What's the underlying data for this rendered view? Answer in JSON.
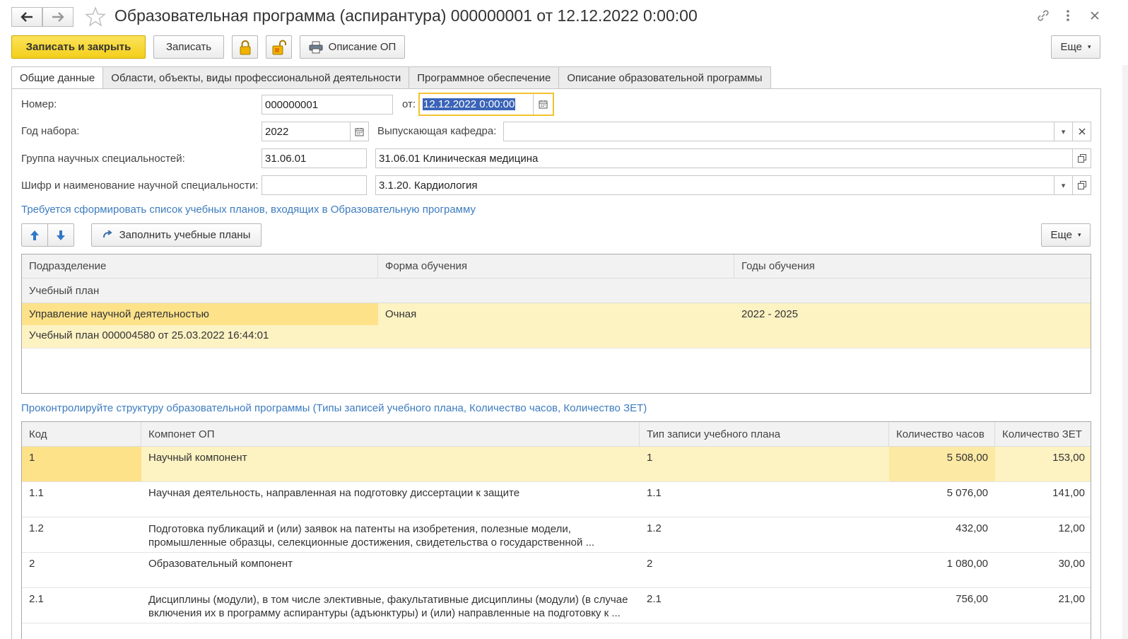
{
  "window": {
    "title": "Образовательная программа (аспирантура) 000000001 от 12.12.2022 0:00:00"
  },
  "toolbar": {
    "save_close": "Записать и закрыть",
    "save": "Записать",
    "description": "Описание ОП",
    "more": "Еще"
  },
  "tabs": [
    {
      "label": "Общие данные"
    },
    {
      "label": "Области, объекты, виды профессиональной деятельности"
    },
    {
      "label": "Программное обеспечение"
    },
    {
      "label": "Описание образовательной программы"
    }
  ],
  "form": {
    "number_label": "Номер:",
    "number_value": "000000001",
    "date_label": "от:",
    "date_value": "12.12.2022  0:00:00",
    "year_label": "Год набора:",
    "year_value": "2022",
    "dept_label": "Выпускающая кафедра:",
    "dept_value": "",
    "group_label": "Группа научных специальностей:",
    "group_code": "31.06.01",
    "group_name": "31.06.01 Клиническая медицина",
    "spec_label": "Шифр и наименование научной специальности:",
    "spec_code": "",
    "spec_name": "3.1.20. Кардиология"
  },
  "plans": {
    "hint": "Требуется сформировать список учебных планов, входящих в Образовательную программу",
    "fill_button": "Заполнить учебные планы",
    "more": "Еще",
    "columns": [
      "Подразделение",
      "Форма обучения",
      "Годы обучения"
    ],
    "subheader": "Учебный план",
    "rows": [
      {
        "department": "Управление научной деятельностью",
        "form": "Очная",
        "years": "2022 - 2025",
        "plan": "Учебный план 000004580 от 25.03.2022 16:44:01"
      }
    ]
  },
  "structure": {
    "hint": "Проконтролируйте структуру образовательной программы  (Типы записей учебного плана, Количество часов, Количество ЗЕТ)",
    "columns": [
      "Код",
      "Компонет ОП",
      "Тип записи учебного плана",
      "Количество часов",
      "Количество ЗЕТ"
    ],
    "rows": [
      {
        "code": "1",
        "component": "Научный компонент",
        "type": "1",
        "hours": "5 508,00",
        "zet": "153,00"
      },
      {
        "code": "1.1",
        "component": "Научная деятельность, направленная на подготовку диссертации к защите",
        "type": "1.1",
        "hours": "5 076,00",
        "zet": "141,00"
      },
      {
        "code": "1.2",
        "component": "Подготовка публикаций и (или) заявок на патенты на изобретения, полезные модели, промышленные образцы, селекционные достижения, свидетельства о государственной ...",
        "type": "1.2",
        "hours": "432,00",
        "zet": "12,00"
      },
      {
        "code": "2",
        "component": "Образовательный компонент",
        "type": "2",
        "hours": "1 080,00",
        "zet": "30,00"
      },
      {
        "code": "2.1",
        "component": "Дисциплины (модули), в том числе элективные, факультативные дисциплины (модули) (в случае включения их в программу аспирантуры (адъюнктуры) и (или) направленные на подготовку к ...",
        "type": "2.1",
        "hours": "756,00",
        "zet": "21,00"
      }
    ]
  }
}
